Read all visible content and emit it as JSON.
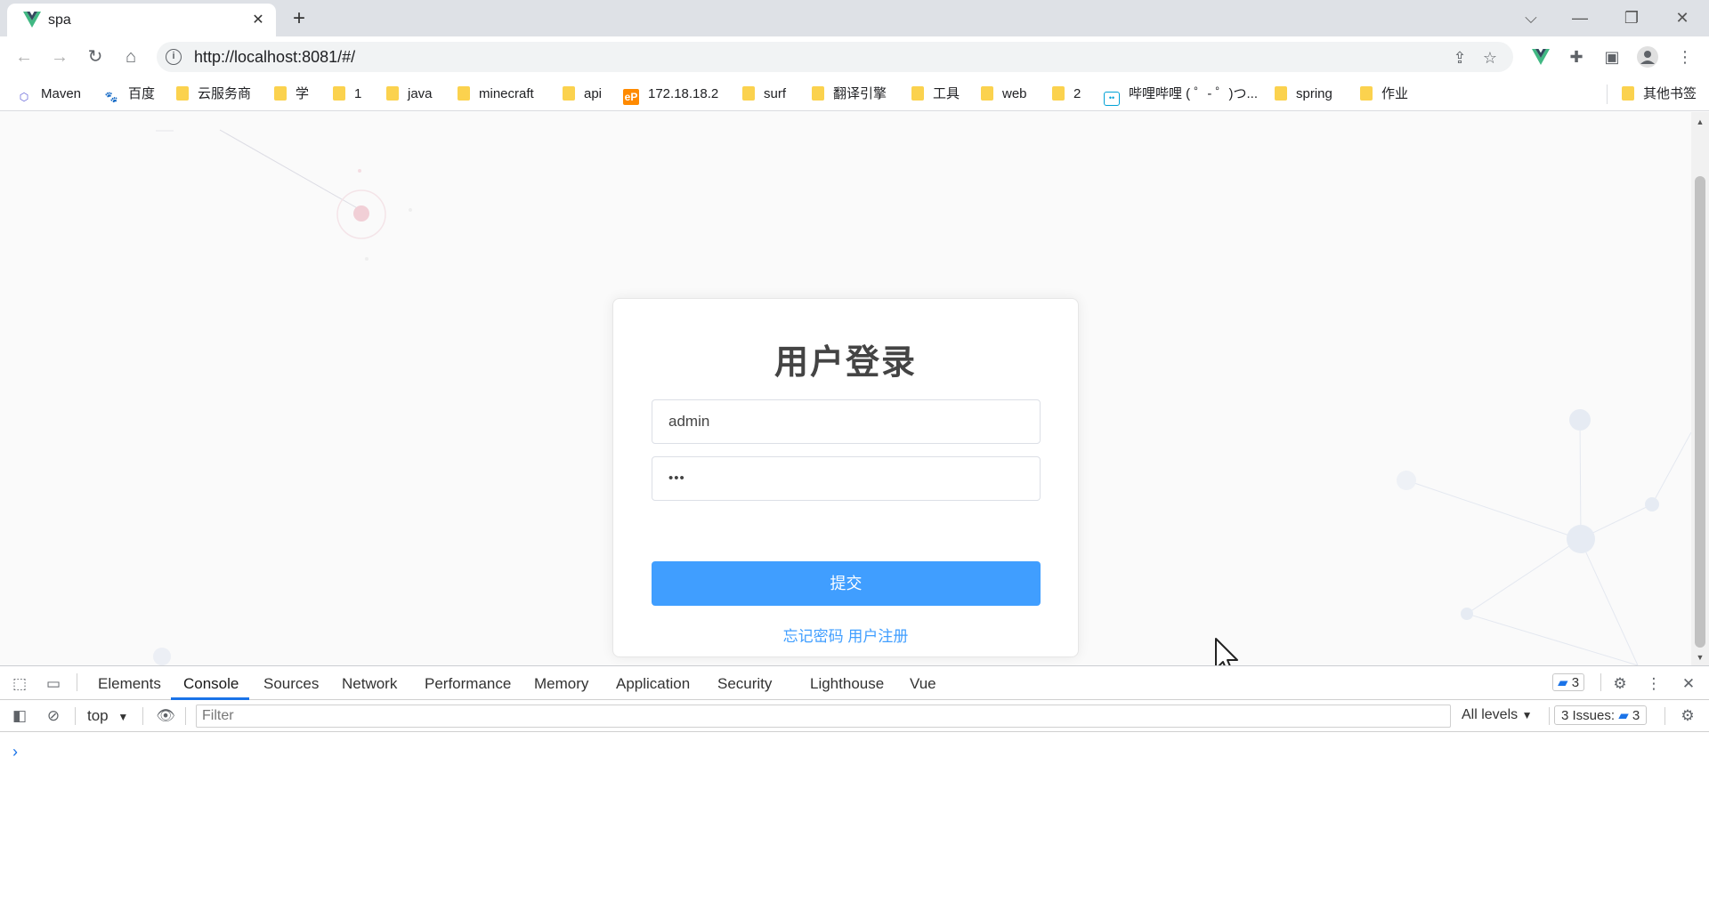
{
  "tab": {
    "title": "spa",
    "close": "✕",
    "new": "+"
  },
  "window": {
    "dropdown": "⌵",
    "minimize": "—",
    "restore": "❐",
    "close": "✕"
  },
  "toolbar": {
    "back": "←",
    "forward": "→",
    "reload": "↻",
    "home": "⌂",
    "url": "http://localhost:8081/#/",
    "more": "⋮"
  },
  "bookmarks": [
    {
      "label": "Maven",
      "icon": "maven-icon"
    },
    {
      "label": "百度",
      "icon": "baidu-icon"
    },
    {
      "label": "云服务商",
      "icon": "folder-icon"
    },
    {
      "label": "学",
      "icon": "folder-icon"
    },
    {
      "label": "1",
      "icon": "folder-icon"
    },
    {
      "label": "java",
      "icon": "folder-icon"
    },
    {
      "label": "minecraft",
      "icon": "folder-icon"
    },
    {
      "label": "api",
      "icon": "folder-icon"
    },
    {
      "label": "172.18.18.2",
      "icon": "ep-icon"
    },
    {
      "label": "surf",
      "icon": "folder-icon"
    },
    {
      "label": "翻译引擎",
      "icon": "folder-icon"
    },
    {
      "label": "工具",
      "icon": "folder-icon"
    },
    {
      "label": "web",
      "icon": "folder-icon"
    },
    {
      "label": "2",
      "icon": "folder-icon"
    },
    {
      "label": "哔哩哔哩 ( ゜- ゜)つ...",
      "icon": "bilibili-icon"
    },
    {
      "label": "spring",
      "icon": "folder-icon"
    },
    {
      "label": "作业",
      "icon": "folder-icon"
    },
    {
      "label": "其他书签",
      "icon": "folder-icon"
    }
  ],
  "login": {
    "title": "用户登录",
    "username_value": "admin",
    "password_value": "•••",
    "submit_label": "提交",
    "forgot_label": "忘记密码",
    "register_label": "用户注册",
    "accent_color": "#409eff"
  },
  "devtools": {
    "tabs": [
      "Elements",
      "Console",
      "Sources",
      "Network",
      "Performance",
      "Memory",
      "Application",
      "Security",
      "Lighthouse",
      "Vue"
    ],
    "active_tab": "Console",
    "message_count": "3",
    "context": "top",
    "filter_placeholder": "Filter",
    "levels": "All levels",
    "issues_label": "3 Issues:",
    "issues_count": "3",
    "prompt": "›"
  }
}
